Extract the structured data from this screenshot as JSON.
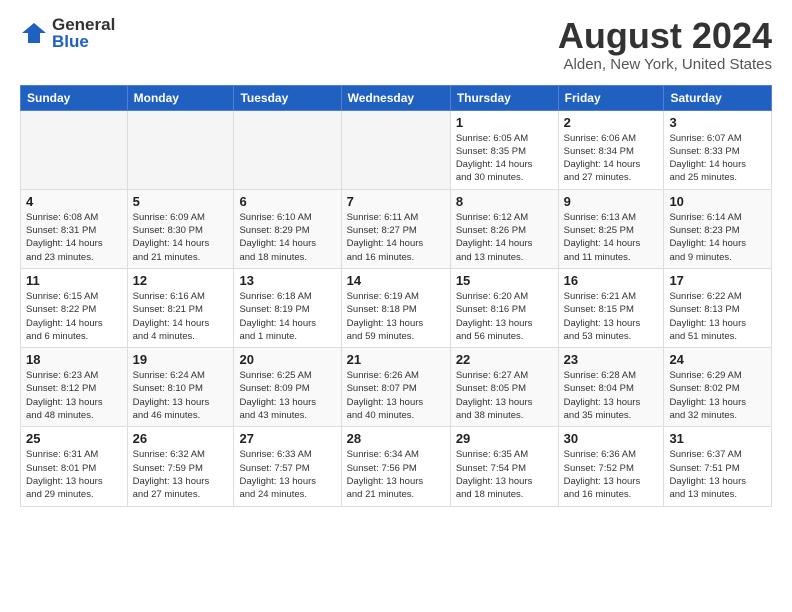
{
  "header": {
    "logo_general": "General",
    "logo_blue": "Blue",
    "month_year": "August 2024",
    "location": "Alden, New York, United States"
  },
  "weekdays": [
    "Sunday",
    "Monday",
    "Tuesday",
    "Wednesday",
    "Thursday",
    "Friday",
    "Saturday"
  ],
  "weeks": [
    [
      {
        "day": "",
        "info": ""
      },
      {
        "day": "",
        "info": ""
      },
      {
        "day": "",
        "info": ""
      },
      {
        "day": "",
        "info": ""
      },
      {
        "day": "1",
        "info": "Sunrise: 6:05 AM\nSunset: 8:35 PM\nDaylight: 14 hours\nand 30 minutes."
      },
      {
        "day": "2",
        "info": "Sunrise: 6:06 AM\nSunset: 8:34 PM\nDaylight: 14 hours\nand 27 minutes."
      },
      {
        "day": "3",
        "info": "Sunrise: 6:07 AM\nSunset: 8:33 PM\nDaylight: 14 hours\nand 25 minutes."
      }
    ],
    [
      {
        "day": "4",
        "info": "Sunrise: 6:08 AM\nSunset: 8:31 PM\nDaylight: 14 hours\nand 23 minutes."
      },
      {
        "day": "5",
        "info": "Sunrise: 6:09 AM\nSunset: 8:30 PM\nDaylight: 14 hours\nand 21 minutes."
      },
      {
        "day": "6",
        "info": "Sunrise: 6:10 AM\nSunset: 8:29 PM\nDaylight: 14 hours\nand 18 minutes."
      },
      {
        "day": "7",
        "info": "Sunrise: 6:11 AM\nSunset: 8:27 PM\nDaylight: 14 hours\nand 16 minutes."
      },
      {
        "day": "8",
        "info": "Sunrise: 6:12 AM\nSunset: 8:26 PM\nDaylight: 14 hours\nand 13 minutes."
      },
      {
        "day": "9",
        "info": "Sunrise: 6:13 AM\nSunset: 8:25 PM\nDaylight: 14 hours\nand 11 minutes."
      },
      {
        "day": "10",
        "info": "Sunrise: 6:14 AM\nSunset: 8:23 PM\nDaylight: 14 hours\nand 9 minutes."
      }
    ],
    [
      {
        "day": "11",
        "info": "Sunrise: 6:15 AM\nSunset: 8:22 PM\nDaylight: 14 hours\nand 6 minutes."
      },
      {
        "day": "12",
        "info": "Sunrise: 6:16 AM\nSunset: 8:21 PM\nDaylight: 14 hours\nand 4 minutes."
      },
      {
        "day": "13",
        "info": "Sunrise: 6:18 AM\nSunset: 8:19 PM\nDaylight: 14 hours\nand 1 minute."
      },
      {
        "day": "14",
        "info": "Sunrise: 6:19 AM\nSunset: 8:18 PM\nDaylight: 13 hours\nand 59 minutes."
      },
      {
        "day": "15",
        "info": "Sunrise: 6:20 AM\nSunset: 8:16 PM\nDaylight: 13 hours\nand 56 minutes."
      },
      {
        "day": "16",
        "info": "Sunrise: 6:21 AM\nSunset: 8:15 PM\nDaylight: 13 hours\nand 53 minutes."
      },
      {
        "day": "17",
        "info": "Sunrise: 6:22 AM\nSunset: 8:13 PM\nDaylight: 13 hours\nand 51 minutes."
      }
    ],
    [
      {
        "day": "18",
        "info": "Sunrise: 6:23 AM\nSunset: 8:12 PM\nDaylight: 13 hours\nand 48 minutes."
      },
      {
        "day": "19",
        "info": "Sunrise: 6:24 AM\nSunset: 8:10 PM\nDaylight: 13 hours\nand 46 minutes."
      },
      {
        "day": "20",
        "info": "Sunrise: 6:25 AM\nSunset: 8:09 PM\nDaylight: 13 hours\nand 43 minutes."
      },
      {
        "day": "21",
        "info": "Sunrise: 6:26 AM\nSunset: 8:07 PM\nDaylight: 13 hours\nand 40 minutes."
      },
      {
        "day": "22",
        "info": "Sunrise: 6:27 AM\nSunset: 8:05 PM\nDaylight: 13 hours\nand 38 minutes."
      },
      {
        "day": "23",
        "info": "Sunrise: 6:28 AM\nSunset: 8:04 PM\nDaylight: 13 hours\nand 35 minutes."
      },
      {
        "day": "24",
        "info": "Sunrise: 6:29 AM\nSunset: 8:02 PM\nDaylight: 13 hours\nand 32 minutes."
      }
    ],
    [
      {
        "day": "25",
        "info": "Sunrise: 6:31 AM\nSunset: 8:01 PM\nDaylight: 13 hours\nand 29 minutes."
      },
      {
        "day": "26",
        "info": "Sunrise: 6:32 AM\nSunset: 7:59 PM\nDaylight: 13 hours\nand 27 minutes."
      },
      {
        "day": "27",
        "info": "Sunrise: 6:33 AM\nSunset: 7:57 PM\nDaylight: 13 hours\nand 24 minutes."
      },
      {
        "day": "28",
        "info": "Sunrise: 6:34 AM\nSunset: 7:56 PM\nDaylight: 13 hours\nand 21 minutes."
      },
      {
        "day": "29",
        "info": "Sunrise: 6:35 AM\nSunset: 7:54 PM\nDaylight: 13 hours\nand 18 minutes."
      },
      {
        "day": "30",
        "info": "Sunrise: 6:36 AM\nSunset: 7:52 PM\nDaylight: 13 hours\nand 16 minutes."
      },
      {
        "day": "31",
        "info": "Sunrise: 6:37 AM\nSunset: 7:51 PM\nDaylight: 13 hours\nand 13 minutes."
      }
    ]
  ]
}
